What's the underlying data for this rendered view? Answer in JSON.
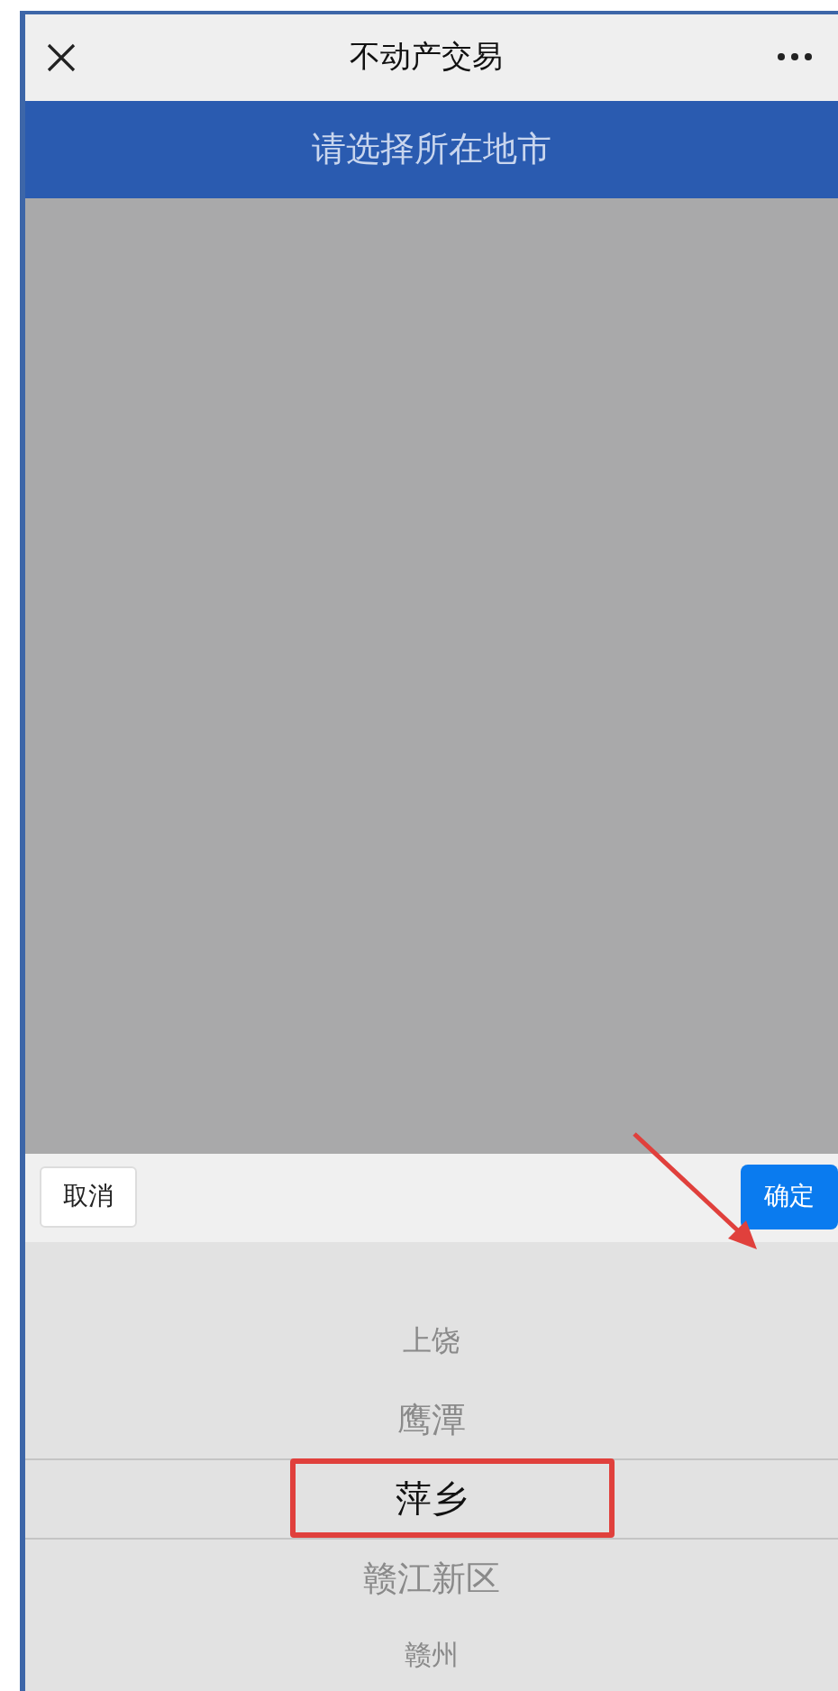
{
  "nav_bar": {
    "title": "不动产交易"
  },
  "banner": {
    "title": "请选择所在地市"
  },
  "picker_toolbar": {
    "cancel": "取消",
    "confirm": "确定"
  },
  "picker_items": [
    {
      "label": "上饶",
      "selected": false
    },
    {
      "label": "鹰潭",
      "selected": false
    },
    {
      "label": "萍乡",
      "selected": true
    },
    {
      "label": "赣江新区",
      "selected": false
    },
    {
      "label": "赣州",
      "selected": false
    }
  ]
}
